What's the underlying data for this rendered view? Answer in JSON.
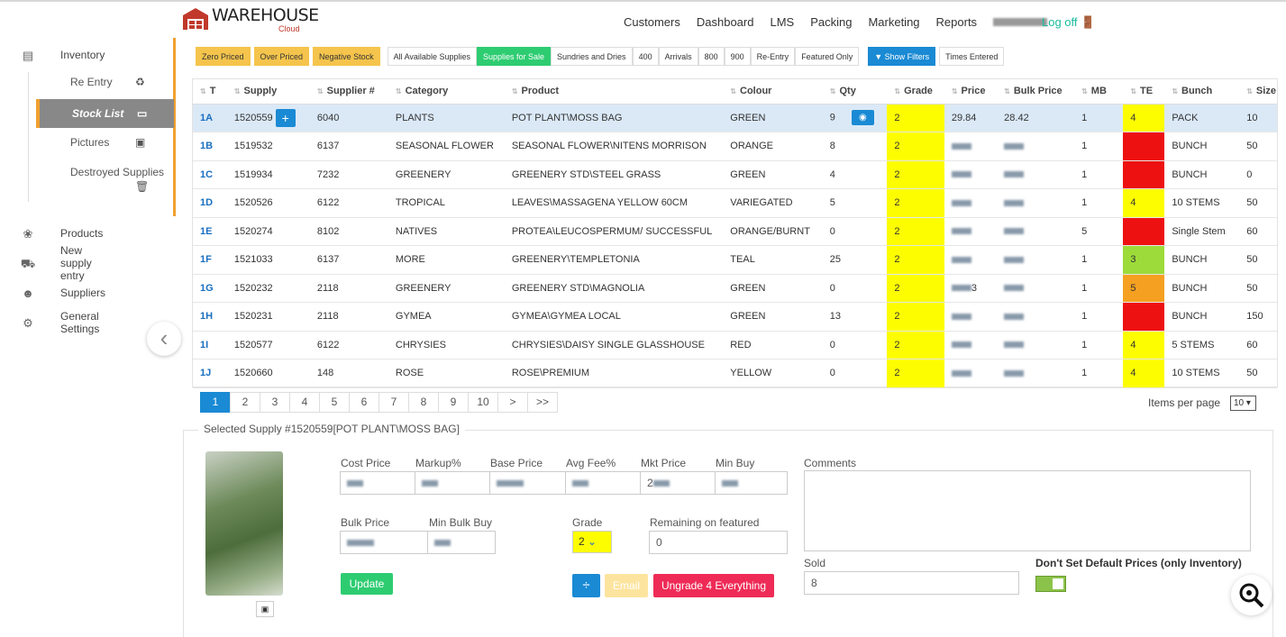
{
  "app": {
    "logo_text": "WAREHOUSE",
    "logo_sub": "Cloud"
  },
  "nav": {
    "items": [
      "Customers",
      "Dashboard",
      "LMS",
      "Packing",
      "Marketing",
      "Reports"
    ],
    "logoff": "Log off"
  },
  "sidebar": {
    "inventory": "Inventory",
    "sub": [
      "Re Entry",
      "Stock List",
      "Pictures",
      "Destroyed Supplies"
    ],
    "items": [
      "Products",
      "New supply entry",
      "Suppliers",
      "General Settings"
    ]
  },
  "filters": {
    "warn": [
      "Zero Priced",
      "Over Priced",
      "Negative Stock"
    ],
    "tabs": [
      "All Available Supplies",
      "Supplies for Sale",
      "Sundries and Dries",
      "400",
      "Arrivals",
      "800",
      "900",
      "Re-Entry",
      "Featured Only"
    ],
    "show_filters": "Show Filters",
    "times_entered": "Times Entered"
  },
  "table": {
    "headers": [
      "T",
      "Supply",
      "Supplier #",
      "Category",
      "Product",
      "Colour",
      "Qty",
      "Grade",
      "Price",
      "Bulk Price",
      "MB",
      "TE",
      "Bunch",
      "Size"
    ],
    "rows": [
      {
        "t": "1A",
        "supply": "1520559",
        "supplier": "6040",
        "category": "PLANTS",
        "product": "POT PLANT\\MOSS BAG",
        "colour": "GREEN",
        "qty": "9",
        "grade": "2",
        "price": "29.84",
        "bulk": "28.42",
        "mb": "1",
        "te": "4",
        "te_color": "yellow",
        "bunch": "PACK",
        "size": "10"
      },
      {
        "t": "1B",
        "supply": "1519532",
        "supplier": "6137",
        "category": "SEASONAL FLOWER",
        "product": "SEASONAL FLOWER\\NITENS MORRISON",
        "colour": "ORANGE",
        "qty": "8",
        "grade": "2",
        "price": "",
        "bulk": "",
        "mb": "1",
        "te": "",
        "te_color": "red",
        "bunch": "BUNCH",
        "size": "50"
      },
      {
        "t": "1C",
        "supply": "1519934",
        "supplier": "7232",
        "category": "GREENERY",
        "product": "GREENERY STD\\STEEL GRASS",
        "colour": "GREEN",
        "qty": "4",
        "grade": "2",
        "price": "",
        "bulk": "",
        "mb": "1",
        "te": "",
        "te_color": "red",
        "bunch": "BUNCH",
        "size": "0"
      },
      {
        "t": "1D",
        "supply": "1520526",
        "supplier": "6122",
        "category": "TROPICAL",
        "product": "LEAVES\\MASSAGENA YELLOW 60CM",
        "colour": "VARIEGATED",
        "qty": "5",
        "grade": "2",
        "price": "",
        "bulk": "",
        "mb": "1",
        "te": "4",
        "te_color": "yellow",
        "bunch": "10 STEMS",
        "size": "50"
      },
      {
        "t": "1E",
        "supply": "1520274",
        "supplier": "8102",
        "category": "NATIVES",
        "product": "PROTEA\\LEUCOSPERMUM/ SUCCESSFUL",
        "colour": "ORANGE/BURNT",
        "qty": "0",
        "grade": "2",
        "price": "",
        "bulk": "",
        "mb": "5",
        "te": "",
        "te_color": "red",
        "bunch": "Single Stem",
        "size": "60"
      },
      {
        "t": "1F",
        "supply": "1521033",
        "supplier": "6137",
        "category": "MORE",
        "product": "GREENERY\\TEMPLETONIA",
        "colour": "TEAL",
        "qty": "25",
        "grade": "2",
        "price": "",
        "bulk": "",
        "mb": "1",
        "te": "3",
        "te_color": "lightgreen",
        "bunch": "BUNCH",
        "size": "50"
      },
      {
        "t": "1G",
        "supply": "1520232",
        "supplier": "2118",
        "category": "GREENERY",
        "product": "GREENERY STD\\MAGNOLIA",
        "colour": "GREEN",
        "qty": "0",
        "grade": "2",
        "price": "3",
        "bulk": "",
        "mb": "1",
        "te": "5",
        "te_color": "orange",
        "bunch": "BUNCH",
        "size": "50"
      },
      {
        "t": "1H",
        "supply": "1520231",
        "supplier": "2118",
        "category": "GYMEA",
        "product": "GYMEA\\GYMEA LOCAL",
        "colour": "GREEN",
        "qty": "13",
        "grade": "2",
        "price": "",
        "bulk": "",
        "mb": "1",
        "te": "",
        "te_color": "red",
        "bunch": "BUNCH",
        "size": "150"
      },
      {
        "t": "1I",
        "supply": "1520577",
        "supplier": "6122",
        "category": "CHRYSIES",
        "product": "CHRYSIES\\DAISY SINGLE GLASSHOUSE",
        "colour": "RED",
        "qty": "0",
        "grade": "2",
        "price": "",
        "bulk": "",
        "mb": "1",
        "te": "4",
        "te_color": "yellow",
        "bunch": "5 STEMS",
        "size": "60"
      },
      {
        "t": "1J",
        "supply": "1520660",
        "supplier": "148",
        "category": "ROSE",
        "product": "ROSE\\PREMIUM",
        "colour": "YELLOW",
        "qty": "0",
        "grade": "2",
        "price": "",
        "bulk": "",
        "mb": "1",
        "te": "4",
        "te_color": "yellow",
        "bunch": "10 STEMS",
        "size": "50"
      }
    ]
  },
  "pager": {
    "pages": [
      "1",
      "2",
      "3",
      "4",
      "5",
      "6",
      "7",
      "8",
      "9",
      "10",
      ">",
      ">>"
    ],
    "items_per_page_label": "Items per page",
    "items_per_page": "10"
  },
  "detail": {
    "title": "Selected Supply #1520559[POT PLANT\\MOSS BAG]",
    "labels": {
      "cost": "Cost Price",
      "markup": "Markup%",
      "base": "Base Price",
      "avgfee": "Avg Fee%",
      "mkt": "Mkt Price",
      "minbuy": "Min Buy",
      "bulk": "Bulk Price",
      "minbulk": "Min Bulk Buy",
      "grade": "Grade",
      "remaining": "Remaining on featured",
      "comments": "Comments",
      "sold": "Sold",
      "default_prices": "Don't Set Default Prices (only Inventory)"
    },
    "values": {
      "mkt_prefix": "2",
      "grade": "2",
      "remaining": "0",
      "sold": "8"
    },
    "buttons": {
      "update": "Update",
      "email": "Email",
      "upgrade": "Ungrade 4 Everything"
    }
  }
}
